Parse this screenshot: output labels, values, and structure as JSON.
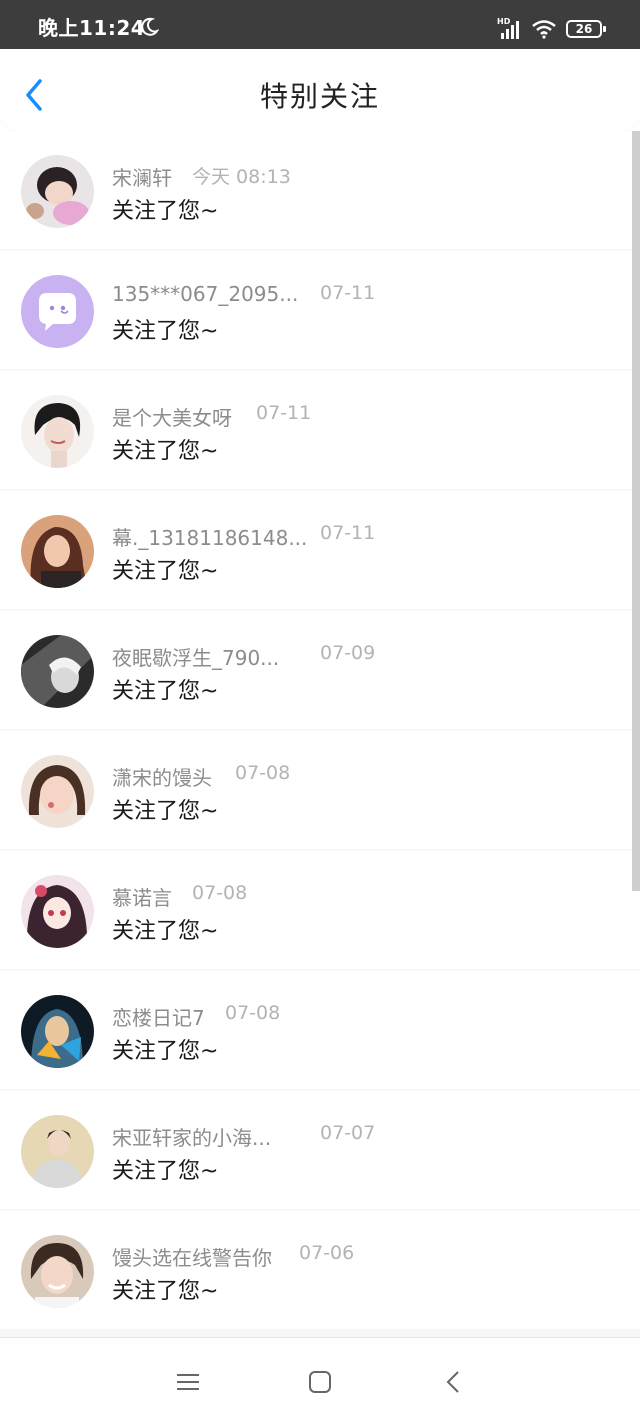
{
  "status_bar": {
    "time": "晚上11:24",
    "network": "HD",
    "battery": "26"
  },
  "header": {
    "title": "特别关注"
  },
  "colors": {
    "accent": "#1a8cff",
    "status_bar_bg": "#3d3d3d"
  },
  "notifications": [
    {
      "name": "宋澜轩",
      "date": "今天 08:13",
      "message": "关注了您~",
      "avatar_icon": "user-photo-avatar"
    },
    {
      "name": "135***067_2095...",
      "date": "07-11",
      "message": "关注了您~",
      "avatar_icon": "chat-bubble-avatar"
    },
    {
      "name": "是个大美女呀",
      "date": "07-11",
      "message": "关注了您~",
      "avatar_icon": "user-photo-avatar"
    },
    {
      "name": "幕._13181186148...",
      "date": "07-11",
      "message": "关注了您~",
      "avatar_icon": "user-photo-avatar"
    },
    {
      "name": "夜眠歇浮生_790...",
      "date": "07-09",
      "message": "关注了您~",
      "avatar_icon": "user-photo-avatar"
    },
    {
      "name": "潇宋的馒头",
      "date": "07-08",
      "message": "关注了您~",
      "avatar_icon": "user-photo-avatar"
    },
    {
      "name": "慕诺言",
      "date": "07-08",
      "message": "关注了您~",
      "avatar_icon": "user-photo-avatar"
    },
    {
      "name": "恋楼日记7",
      "date": "07-08",
      "message": "关注了您~",
      "avatar_icon": "user-photo-avatar"
    },
    {
      "name": "宋亚轩家的小海...",
      "date": "07-07",
      "message": "关注了您~",
      "avatar_icon": "user-photo-avatar"
    },
    {
      "name": "馒头选在线警告你",
      "date": "07-06",
      "message": "关注了您~",
      "avatar_icon": "user-photo-avatar"
    }
  ],
  "nav_bar": {
    "menu_icon": "menu-icon",
    "home_icon": "home-square-icon",
    "back_icon": "back-chevron-icon"
  }
}
